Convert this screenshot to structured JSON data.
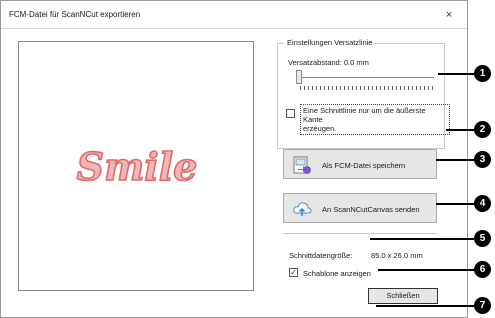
{
  "window": {
    "title": "FCM-Datei für ScanNCut exportieren",
    "close_glyph": "×"
  },
  "preview": {
    "text": "Smile",
    "text_fill": "#f2b6b6",
    "text_stroke": "#e06a6a"
  },
  "offset_group": {
    "legend": "Einstellungen Versatzlinie",
    "label": "Versatzabstand: 0.0 mm",
    "slider_level": 0,
    "outer_only_checked": false,
    "outer_only_label_line1": "Eine Schnittlinie nur um die äußerste Kante",
    "outer_only_label_line2": "erzeugen."
  },
  "buttons": {
    "save_fcm": "Als FCM-Datei speichern",
    "send_canvas": "An ScanNCutCanvas senden",
    "close": "Schließen"
  },
  "cut_size": {
    "label": "Schnittdatengröße:",
    "value": "85.0 x 26.0 mm"
  },
  "template": {
    "checked": true,
    "check_glyph": "✓",
    "label": "Schablone anzeigen"
  },
  "callouts": [
    "1",
    "2",
    "3",
    "4",
    "5",
    "6",
    "7"
  ]
}
